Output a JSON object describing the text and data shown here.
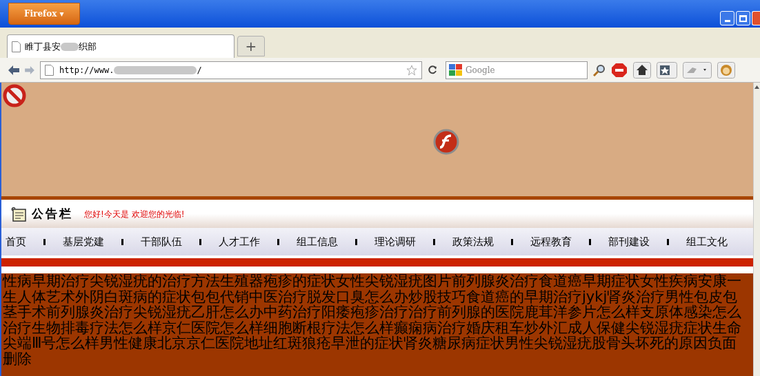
{
  "window": {
    "app_button": "Firefox ▾"
  },
  "tabs": [
    {
      "title_start": "睢丁县安",
      "title_end": "织部",
      "selected": true
    }
  ],
  "new_tab": "+",
  "address_bar": {
    "url_start": "http://www.",
    "url_end": "/"
  },
  "search": {
    "placeholder": "Google"
  },
  "banner": {
    "kind": "flash"
  },
  "notice": {
    "title": "公告栏",
    "message": "您好!今天是 欢迎您的光临!"
  },
  "menu": [
    "首页",
    "基层党建",
    "干部队伍",
    "人才工作",
    "组工信息",
    "理论调研",
    "政策法规",
    "远程教育",
    "部刊建设",
    "组工文化"
  ],
  "spam_text": "性病早期治疗尖锐湿疣的治疗方法生殖器疱疹的症状女性尖锐湿疣图片前列腺炎治疗食道癌早期症状女性疾病安康一生人体艺术外阴白斑病的症状包包代销中医治疗脱发口臭怎么办炒股技巧食道癌的早期治疗jykj肾炎治疗男性包皮包茎手术前列腺炎治疗尖锐湿疣乙肝怎么办中药治疗阳痿疱疹治疗治疗前列腺的医院鹿茸洋参片怎么样支原体感染怎么治疗生物排毒疗法怎么样京仁医院怎么样细胞断根疗法怎么样癫痫病治疗婚庆租车炒外汇成人保健尖锐湿疣症状生命尖端Ⅲ号怎么样男性健康北京京仁医院地址红斑狼疮早泄的症状肾炎糖尿病症状男性尖锐湿疣股骨头坏死的原因负面删除"
}
